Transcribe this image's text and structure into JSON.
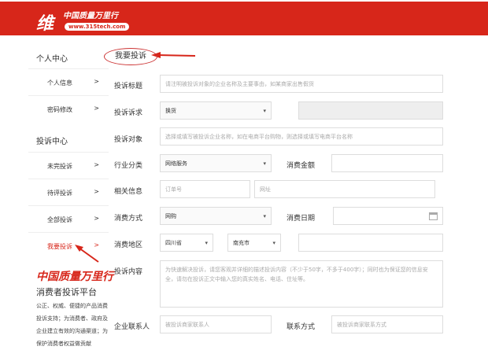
{
  "header": {
    "logo_char": "维",
    "brand": "中国质量万里行",
    "url": "www.315tech.com"
  },
  "sidebar": {
    "section1": "个人中心",
    "items1": [
      {
        "label": "个人信息",
        "arrow": ">"
      },
      {
        "label": "密码修改",
        "arrow": ">"
      }
    ],
    "section2": "投诉中心",
    "items2": [
      {
        "label": "未完投诉",
        "arrow": ">"
      },
      {
        "label": "待评投诉",
        "arrow": ">"
      },
      {
        "label": "全部投诉",
        "arrow": ">"
      },
      {
        "label": "我要投诉",
        "arrow": ">"
      }
    ],
    "brand": "中国质量万里行",
    "platform_title": "消费者投诉平台",
    "platform_desc": "公正、权威、便捷的产品消费投诉支持；为消费者、政府及企业建立有效的沟通渠道；为保护消费者权益做贡献"
  },
  "form": {
    "title": "我要投诉",
    "subject": {
      "label": "投诉标题",
      "placeholder": "请注明被投诉对象的企业名称及主要事由，如某商家出售假货"
    },
    "demand": {
      "label": "投诉诉求",
      "value": "换货"
    },
    "target": {
      "label": "投诉对象",
      "placeholder": "选择或填写被投诉企业名称，如在电商平台购物，则选择或填写电商平台名称"
    },
    "industry": {
      "label": "行业分类",
      "value": "网络服务"
    },
    "amount": {
      "label": "消费金额"
    },
    "related": {
      "label": "相关信息",
      "order_placeholder": "订单号",
      "url_placeholder": "网址"
    },
    "method": {
      "label": "消费方式",
      "value": "网购"
    },
    "date": {
      "label": "消费日期"
    },
    "region": {
      "label": "消费地区",
      "province": "四川省",
      "city": "南充市"
    },
    "content": {
      "label": "投诉内容",
      "placeholder": "为快速解决投诉，请您客观并详细的描述投诉内容（不少于50字，不多于400字）；同时也为保证您的信息安全，请勿在投诉正文中输入您的真实姓名、电话、住址等。"
    },
    "contact": {
      "label": "企业联系人",
      "placeholder": "被投诉商家联系人"
    },
    "contact_method": {
      "label": "联系方式",
      "placeholder": "被投诉商家联系方式"
    }
  },
  "colors": {
    "brand_red": "#d7261a"
  }
}
